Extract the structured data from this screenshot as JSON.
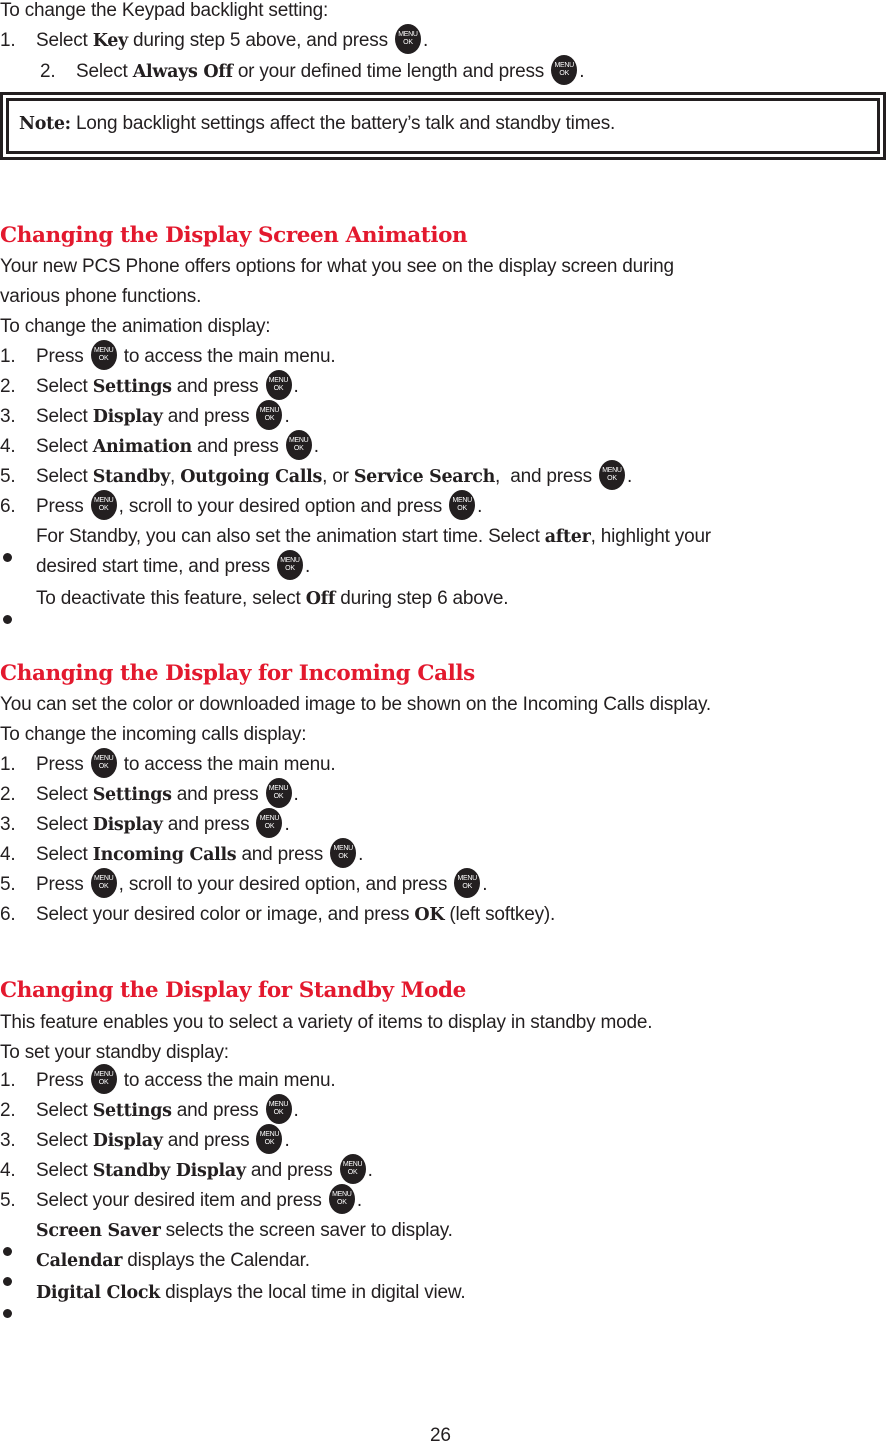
{
  "intro": {
    "lead": "To change the Keypad backlight setting:",
    "step1": {
      "num": "1.",
      "pre": "Select ",
      "bold": "Key",
      "post": " during step 5 above, and press ",
      "end": "."
    },
    "step2": {
      "num": "2.",
      "pre": "Select ",
      "bold": "Always Off",
      "post": " or your defined time length and press ",
      "end": "."
    }
  },
  "note": {
    "label": "Note:",
    "text": " Long backlight settings affect the battery’s talk and standby times."
  },
  "key_icon": {
    "name": "menu-ok-key",
    "top": "MENU",
    "bottom": "OK"
  },
  "section1": {
    "title": "Changing the Display Screen Animation",
    "para1": "Your new PCS Phone offers options for what you see on the display screen during",
    "para2": "various phone functions.",
    "lead": "To change the animation display:",
    "s1": {
      "num": "1.",
      "pre": "Press ",
      "post": " to access the main menu."
    },
    "s2": {
      "num": "2.",
      "pre": "Select ",
      "bold": "Settings",
      "post": " and press ",
      "end": "."
    },
    "s3": {
      "num": "3.",
      "pre": "Select ",
      "bold": "Display",
      "post": " and press ",
      "end": "."
    },
    "s4": {
      "num": "4.",
      "pre": "Select ",
      "bold": "Animation",
      "post": " and press ",
      "end": "."
    },
    "s5": {
      "num": "5.",
      "pre": "Select ",
      "bold1": "Standby",
      "sep1": ", ",
      "bold2": "Outgoing Calls",
      "sep2": ", or ",
      "bold3": "Service Search",
      "post": ",  and press ",
      "end": "."
    },
    "s6": {
      "num": "6.",
      "pre": "Press ",
      "mid": ", scroll to your desired option and press ",
      "end": "."
    },
    "b1": {
      "pre": "For Standby, you can also set the animation start time. Select ",
      "bold": "after",
      "post": ", highlight your",
      "line2": "desired start time, and press ",
      "end": "."
    },
    "b2": {
      "pre": "To deactivate this feature, select ",
      "bold": "Off",
      "post": " during step 6 above."
    }
  },
  "section2": {
    "title": "Changing the Display for Incoming Calls",
    "para1": "You can set the color or downloaded image to be shown on the Incoming Calls display.",
    "lead": "To change the incoming calls display:",
    "s1": {
      "num": "1.",
      "pre": "Press ",
      "post": " to access the main menu."
    },
    "s2": {
      "num": "2.",
      "pre": "Select ",
      "bold": "Settings",
      "post": " and press ",
      "end": "."
    },
    "s3": {
      "num": "3.",
      "pre": "Select ",
      "bold": "Display",
      "post": " and press ",
      "end": "."
    },
    "s4": {
      "num": "4.",
      "pre": "Select ",
      "bold": "Incoming Calls",
      "post": " and press ",
      "end": "."
    },
    "s5": {
      "num": "5.",
      "pre": "Press ",
      "mid": ", scroll to your desired option, and press ",
      "end": "."
    },
    "s6": {
      "num": "6.",
      "pre": "Select your desired color or image, and press ",
      "bold": "OK",
      "post": " (left softkey)."
    }
  },
  "section3": {
    "title": "Changing the Display for Standby Mode",
    "para1": "This feature enables you to select a variety of items to display in standby mode.",
    "lead": "To set your standby display:",
    "s1": {
      "num": "1.",
      "pre": "Press ",
      "post": " to access the main menu."
    },
    "s2": {
      "num": "2.",
      "pre": "Select ",
      "bold": "Settings",
      "post": " and press ",
      "end": "."
    },
    "s3": {
      "num": "3.",
      "pre": "Select ",
      "bold": "Display",
      "post": " and press ",
      "end": "."
    },
    "s4": {
      "num": "4.",
      "pre": "Select ",
      "bold": "Standby Display",
      "post": " and press ",
      "end": "."
    },
    "s5": {
      "num": "5.",
      "pre": "Select your desired item and press ",
      "end": "."
    },
    "b1": {
      "bold": "Screen Saver",
      "post": " selects the screen saver to display."
    },
    "b2": {
      "bold": "Calendar",
      "post": " displays the Calendar."
    },
    "b3": {
      "bold": "Digital Clock",
      "post": " displays the local time in digital view."
    }
  },
  "page_number": "26"
}
